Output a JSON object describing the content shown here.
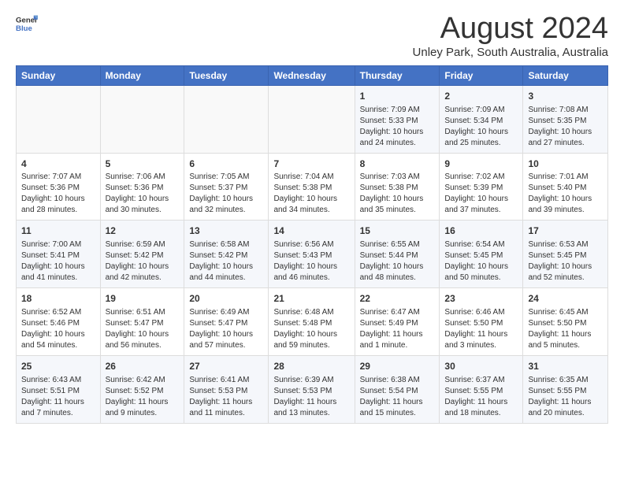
{
  "header": {
    "logo": {
      "line1": "General",
      "line2": "Blue"
    },
    "title": "August 2024",
    "subtitle": "Unley Park, South Australia, Australia"
  },
  "weekdays": [
    "Sunday",
    "Monday",
    "Tuesday",
    "Wednesday",
    "Thursday",
    "Friday",
    "Saturday"
  ],
  "weeks": [
    [
      {
        "day": "",
        "sunrise": "",
        "sunset": "",
        "daylight": ""
      },
      {
        "day": "",
        "sunrise": "",
        "sunset": "",
        "daylight": ""
      },
      {
        "day": "",
        "sunrise": "",
        "sunset": "",
        "daylight": ""
      },
      {
        "day": "",
        "sunrise": "",
        "sunset": "",
        "daylight": ""
      },
      {
        "day": "1",
        "sunrise": "Sunrise: 7:09 AM",
        "sunset": "Sunset: 5:33 PM",
        "daylight": "Daylight: 10 hours and 24 minutes."
      },
      {
        "day": "2",
        "sunrise": "Sunrise: 7:09 AM",
        "sunset": "Sunset: 5:34 PM",
        "daylight": "Daylight: 10 hours and 25 minutes."
      },
      {
        "day": "3",
        "sunrise": "Sunrise: 7:08 AM",
        "sunset": "Sunset: 5:35 PM",
        "daylight": "Daylight: 10 hours and 27 minutes."
      }
    ],
    [
      {
        "day": "4",
        "sunrise": "Sunrise: 7:07 AM",
        "sunset": "Sunset: 5:36 PM",
        "daylight": "Daylight: 10 hours and 28 minutes."
      },
      {
        "day": "5",
        "sunrise": "Sunrise: 7:06 AM",
        "sunset": "Sunset: 5:36 PM",
        "daylight": "Daylight: 10 hours and 30 minutes."
      },
      {
        "day": "6",
        "sunrise": "Sunrise: 7:05 AM",
        "sunset": "Sunset: 5:37 PM",
        "daylight": "Daylight: 10 hours and 32 minutes."
      },
      {
        "day": "7",
        "sunrise": "Sunrise: 7:04 AM",
        "sunset": "Sunset: 5:38 PM",
        "daylight": "Daylight: 10 hours and 34 minutes."
      },
      {
        "day": "8",
        "sunrise": "Sunrise: 7:03 AM",
        "sunset": "Sunset: 5:38 PM",
        "daylight": "Daylight: 10 hours and 35 minutes."
      },
      {
        "day": "9",
        "sunrise": "Sunrise: 7:02 AM",
        "sunset": "Sunset: 5:39 PM",
        "daylight": "Daylight: 10 hours and 37 minutes."
      },
      {
        "day": "10",
        "sunrise": "Sunrise: 7:01 AM",
        "sunset": "Sunset: 5:40 PM",
        "daylight": "Daylight: 10 hours and 39 minutes."
      }
    ],
    [
      {
        "day": "11",
        "sunrise": "Sunrise: 7:00 AM",
        "sunset": "Sunset: 5:41 PM",
        "daylight": "Daylight: 10 hours and 41 minutes."
      },
      {
        "day": "12",
        "sunrise": "Sunrise: 6:59 AM",
        "sunset": "Sunset: 5:42 PM",
        "daylight": "Daylight: 10 hours and 42 minutes."
      },
      {
        "day": "13",
        "sunrise": "Sunrise: 6:58 AM",
        "sunset": "Sunset: 5:42 PM",
        "daylight": "Daylight: 10 hours and 44 minutes."
      },
      {
        "day": "14",
        "sunrise": "Sunrise: 6:56 AM",
        "sunset": "Sunset: 5:43 PM",
        "daylight": "Daylight: 10 hours and 46 minutes."
      },
      {
        "day": "15",
        "sunrise": "Sunrise: 6:55 AM",
        "sunset": "Sunset: 5:44 PM",
        "daylight": "Daylight: 10 hours and 48 minutes."
      },
      {
        "day": "16",
        "sunrise": "Sunrise: 6:54 AM",
        "sunset": "Sunset: 5:45 PM",
        "daylight": "Daylight: 10 hours and 50 minutes."
      },
      {
        "day": "17",
        "sunrise": "Sunrise: 6:53 AM",
        "sunset": "Sunset: 5:45 PM",
        "daylight": "Daylight: 10 hours and 52 minutes."
      }
    ],
    [
      {
        "day": "18",
        "sunrise": "Sunrise: 6:52 AM",
        "sunset": "Sunset: 5:46 PM",
        "daylight": "Daylight: 10 hours and 54 minutes."
      },
      {
        "day": "19",
        "sunrise": "Sunrise: 6:51 AM",
        "sunset": "Sunset: 5:47 PM",
        "daylight": "Daylight: 10 hours and 56 minutes."
      },
      {
        "day": "20",
        "sunrise": "Sunrise: 6:49 AM",
        "sunset": "Sunset: 5:47 PM",
        "daylight": "Daylight: 10 hours and 57 minutes."
      },
      {
        "day": "21",
        "sunrise": "Sunrise: 6:48 AM",
        "sunset": "Sunset: 5:48 PM",
        "daylight": "Daylight: 10 hours and 59 minutes."
      },
      {
        "day": "22",
        "sunrise": "Sunrise: 6:47 AM",
        "sunset": "Sunset: 5:49 PM",
        "daylight": "Daylight: 11 hours and 1 minute."
      },
      {
        "day": "23",
        "sunrise": "Sunrise: 6:46 AM",
        "sunset": "Sunset: 5:50 PM",
        "daylight": "Daylight: 11 hours and 3 minutes."
      },
      {
        "day": "24",
        "sunrise": "Sunrise: 6:45 AM",
        "sunset": "Sunset: 5:50 PM",
        "daylight": "Daylight: 11 hours and 5 minutes."
      }
    ],
    [
      {
        "day": "25",
        "sunrise": "Sunrise: 6:43 AM",
        "sunset": "Sunset: 5:51 PM",
        "daylight": "Daylight: 11 hours and 7 minutes."
      },
      {
        "day": "26",
        "sunrise": "Sunrise: 6:42 AM",
        "sunset": "Sunset: 5:52 PM",
        "daylight": "Daylight: 11 hours and 9 minutes."
      },
      {
        "day": "27",
        "sunrise": "Sunrise: 6:41 AM",
        "sunset": "Sunset: 5:53 PM",
        "daylight": "Daylight: 11 hours and 11 minutes."
      },
      {
        "day": "28",
        "sunrise": "Sunrise: 6:39 AM",
        "sunset": "Sunset: 5:53 PM",
        "daylight": "Daylight: 11 hours and 13 minutes."
      },
      {
        "day": "29",
        "sunrise": "Sunrise: 6:38 AM",
        "sunset": "Sunset: 5:54 PM",
        "daylight": "Daylight: 11 hours and 15 minutes."
      },
      {
        "day": "30",
        "sunrise": "Sunrise: 6:37 AM",
        "sunset": "Sunset: 5:55 PM",
        "daylight": "Daylight: 11 hours and 18 minutes."
      },
      {
        "day": "31",
        "sunrise": "Sunrise: 6:35 AM",
        "sunset": "Sunset: 5:55 PM",
        "daylight": "Daylight: 11 hours and 20 minutes."
      }
    ]
  ]
}
